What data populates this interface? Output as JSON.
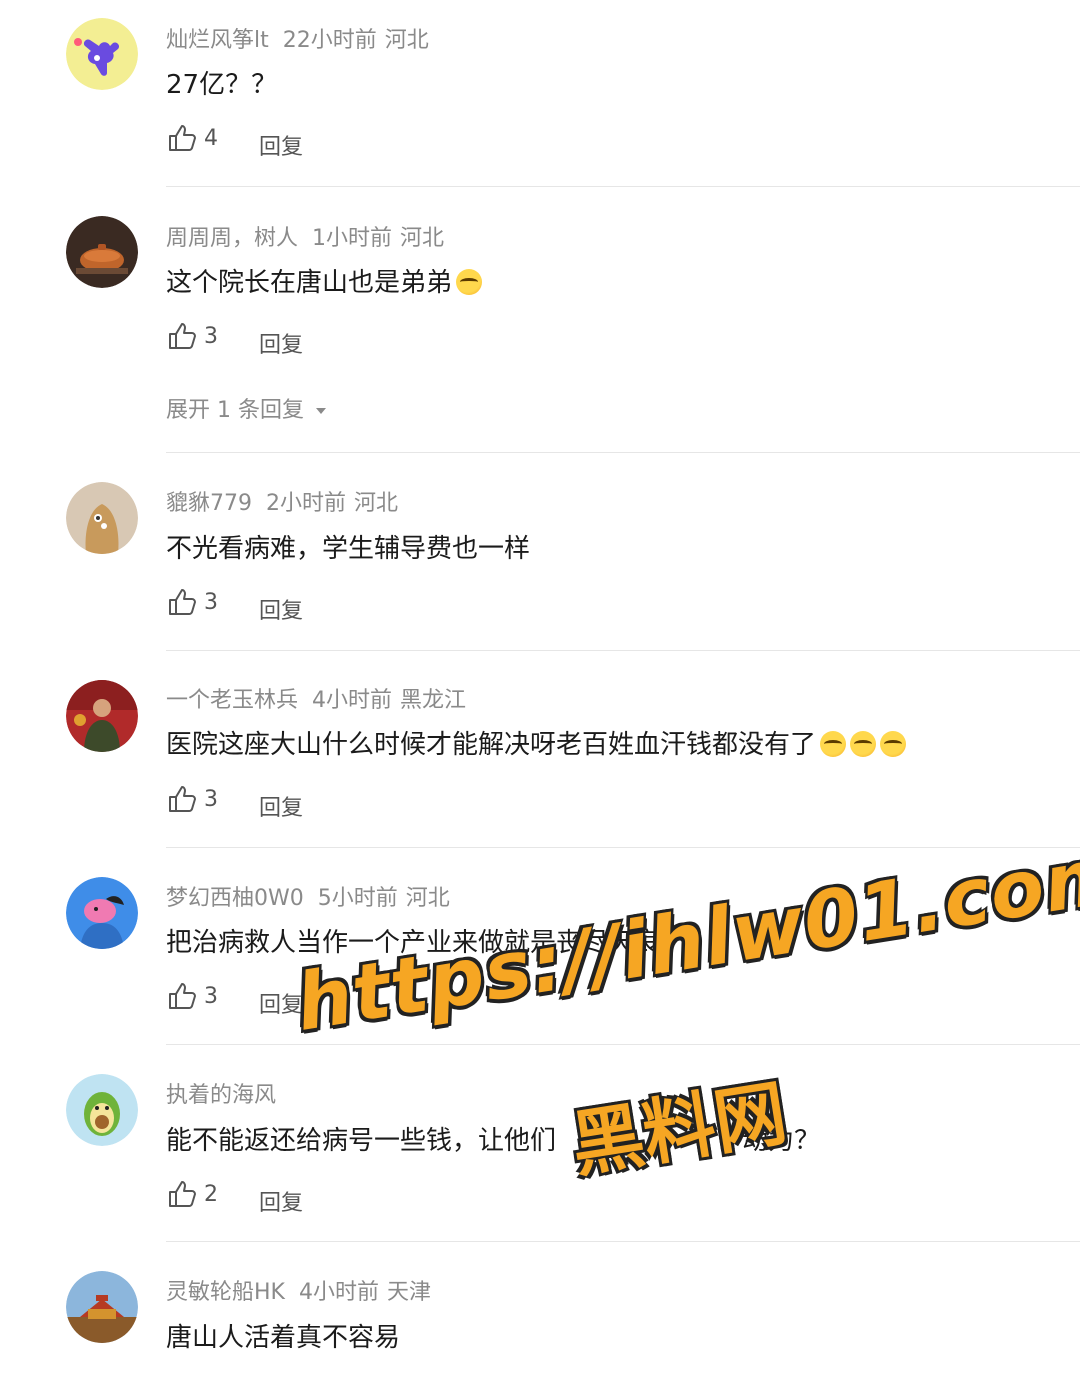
{
  "comments": [
    {
      "name": "灿烂风筝lt",
      "time": "22小时前",
      "location": "河北",
      "text": "27亿？？",
      "emoji_count": 0,
      "likes": "4",
      "reply": "回复"
    },
    {
      "name": "周周周，树人",
      "time": "1小时前",
      "location": "河北",
      "text": "这个院长在唐山也是弟弟",
      "emoji_count": 1,
      "likes": "3",
      "reply": "回复",
      "expand": "展开 1 条回复"
    },
    {
      "name": "貔貅779",
      "time": "2小时前",
      "location": "河北",
      "text": "不光看病难，学生辅导费也一样",
      "emoji_count": 0,
      "likes": "3",
      "reply": "回复"
    },
    {
      "name": "一个老玉林兵",
      "time": "4小时前",
      "location": "黑龙江",
      "text": "医院这座大山什么时候才能解决呀老百姓血汗钱都没有了",
      "emoji_count": 3,
      "likes": "3",
      "reply": "回复"
    },
    {
      "name": "梦幻西柚0W0",
      "time": "5小时前",
      "location": "河北",
      "text": "把治病救人当作一个产业来做就是丧尽天良。",
      "emoji_count": 0,
      "likes": "3",
      "reply": "回复"
    },
    {
      "name": "执着的海风",
      "time": "",
      "location": "",
      "text": "能不能返还给病号一些钱，让他们",
      "text_tail": "动力？",
      "emoji_count": 0,
      "likes": "2",
      "reply": "回复"
    },
    {
      "name": "灵敏轮船HK",
      "time": "4小时前",
      "location": "天津",
      "text": "唐山人活着真不容易",
      "emoji_count": 0,
      "likes": "",
      "reply": ""
    }
  ],
  "watermark": {
    "url": "https://ihlw01.com",
    "name": "黑料网"
  },
  "icons": {
    "like": "thumbs-up-icon",
    "expand": "chevron-down-icon"
  },
  "colors": {
    "meta": "#8a8a8a",
    "text": "#1b1b1b",
    "watermark": "#f6a623"
  }
}
